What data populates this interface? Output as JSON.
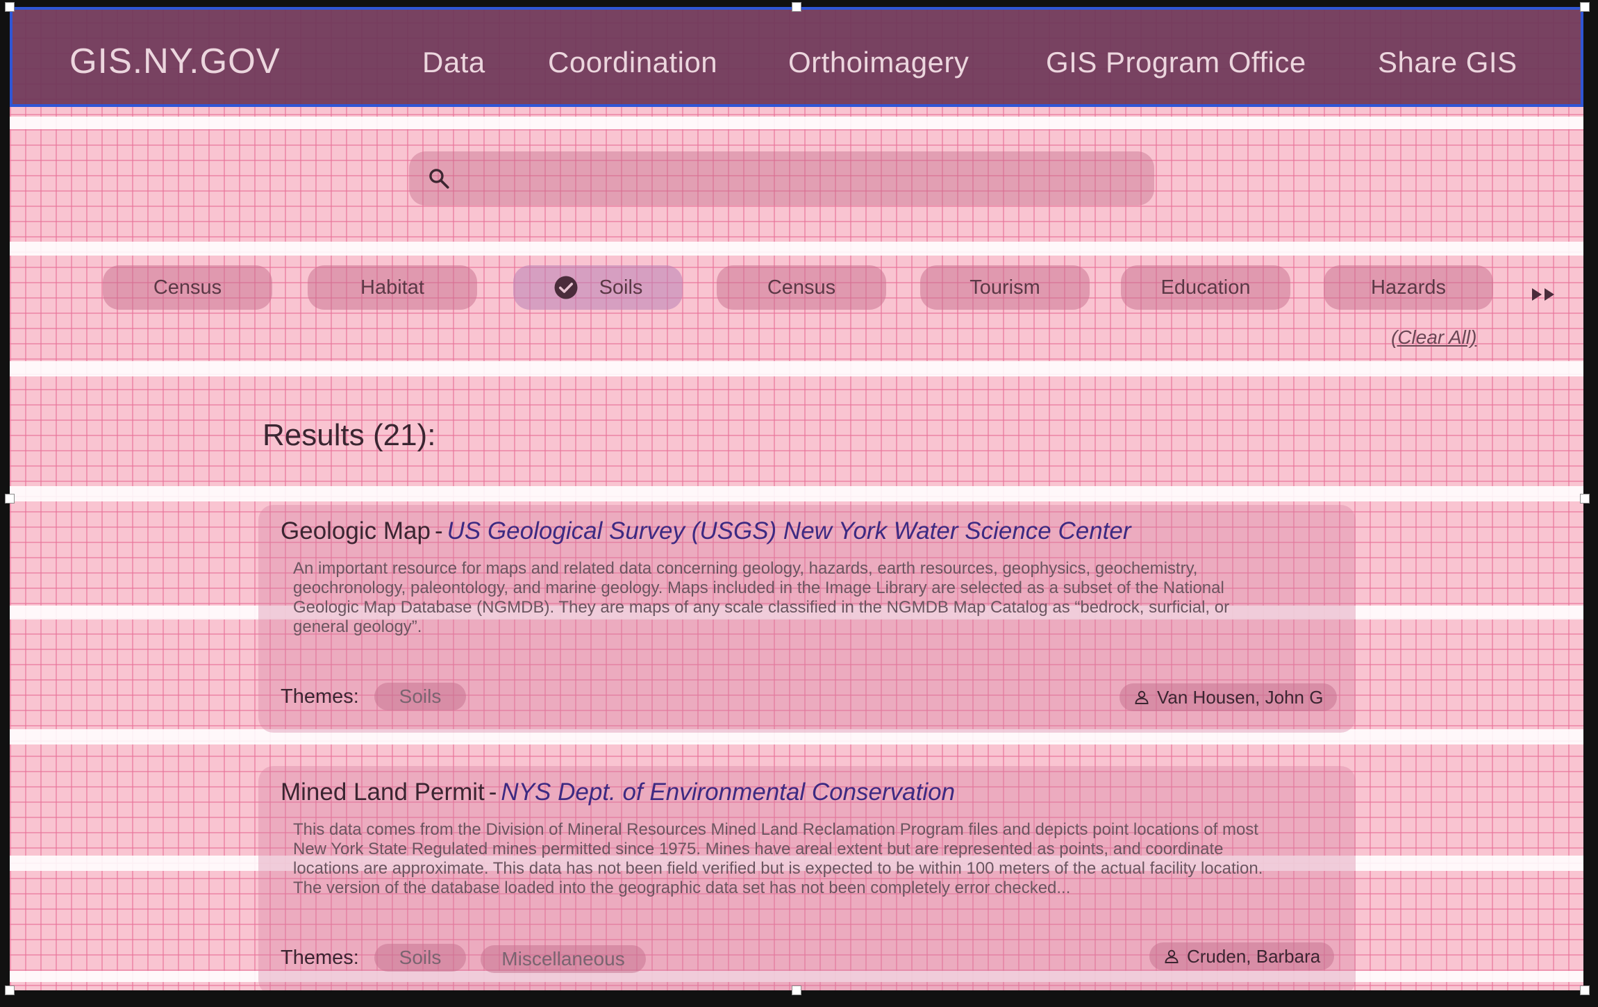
{
  "header": {
    "logo": "GIS.NY.GOV",
    "nav": [
      "Data",
      "Coordination",
      "Orthoimagery",
      "GIS Program Office",
      "Share GIS"
    ]
  },
  "search": {
    "value": "",
    "icon": "search-icon"
  },
  "filters": {
    "chips": [
      {
        "label": "Census",
        "selected": false
      },
      {
        "label": "Habitat",
        "selected": false
      },
      {
        "label": "Soils",
        "selected": true
      },
      {
        "label": "Census",
        "selected": false
      },
      {
        "label": "Tourism",
        "selected": false
      },
      {
        "label": "Education",
        "selected": false
      },
      {
        "label": "Hazards",
        "selected": false
      }
    ],
    "clear_all": "(Clear All)",
    "more_icon": "double-chevron-right-icon"
  },
  "results": {
    "title": "Results (21):",
    "items": [
      {
        "title": "Geologic Map",
        "separator": "-",
        "publisher": "US Geological Survey (USGS) New York Water Science Center",
        "description": "An important resource for maps and related data concerning geology, hazards, earth resources, geophysics, geochemistry, geochronology, paleontology, and marine geology. Maps included in the Image Library are selected as a subset of the National Geologic Map Database (NGMDB). They are maps of any scale classified in the NGMDB Map Catalog as “bedrock, surficial, or general geology”.",
        "themes_label": "Themes:",
        "themes": [
          "Soils"
        ],
        "author": "Van Housen, John G"
      },
      {
        "title": "Mined Land Permit",
        "separator": "-",
        "publisher": "NYS Dept. of Environmental Conservation",
        "description": "This data comes from the Division of Mineral Resources Mined Land Reclamation Program files and depicts point locations of most New York State Regulated mines permitted since 1975. Mines have areal extent but are represented as points, and coordinate locations are approximate. This data has not been field verified but is expected to be within 100 meters of the actual facility location. The version of the database loaded into the geographic data set has not been completely error checked...",
        "themes_label": "Themes:",
        "themes": [
          "Soils",
          "Miscellaneous"
        ],
        "author": "Cruden, Barbara"
      }
    ]
  },
  "colors": {
    "header_bg": "#6e3858",
    "selection_border": "#2f56d6",
    "publisher_text": "#3d2a82",
    "overlay_pink": "#f9c4d1"
  }
}
